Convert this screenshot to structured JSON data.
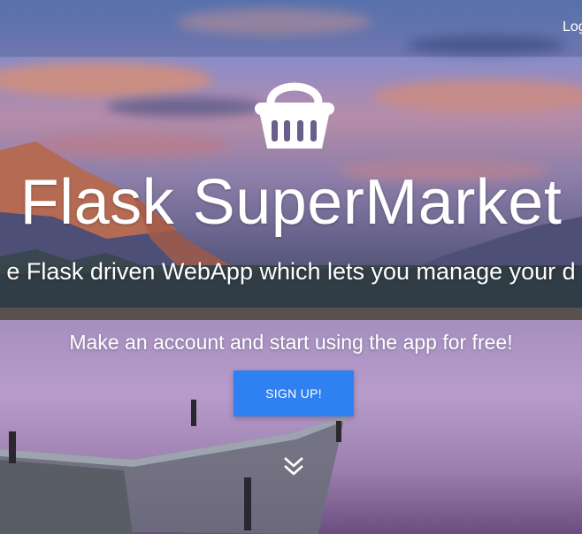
{
  "nav": {
    "login_label": "Log"
  },
  "hero": {
    "icon": "shopping-basket-icon",
    "title": "Flask SuperMarket",
    "subtitle": "e Flask driven WebApp which lets you manage your d",
    "cta_text": "Make an account and start using the app for free!",
    "signup_label": "SIGN UP!",
    "scroll_icon": "double-chevron-down-icon"
  },
  "colors": {
    "primary_button": "#2f80f0",
    "text": "#ffffff"
  }
}
